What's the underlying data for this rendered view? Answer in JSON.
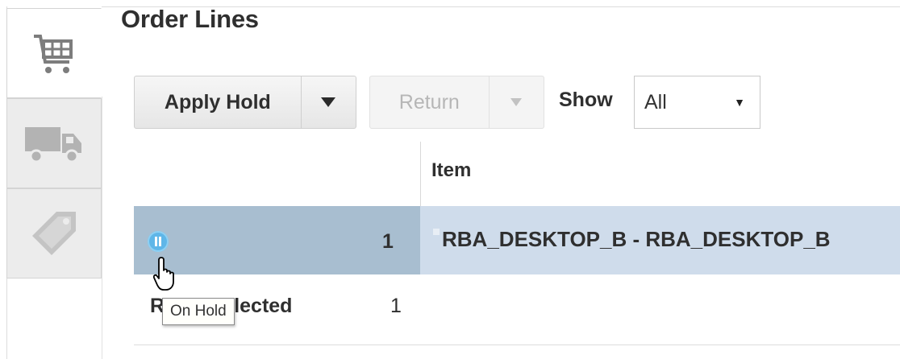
{
  "page": {
    "title": "Order Lines"
  },
  "side_tabs": [
    {
      "icon": "shopping-cart-icon",
      "active": true
    },
    {
      "icon": "truck-icon",
      "active": false
    },
    {
      "icon": "price-tag-icon",
      "active": false
    }
  ],
  "toolbar": {
    "apply_hold_label": "Apply Hold",
    "return_label": "Return",
    "show_label": "Show",
    "show_value": "All"
  },
  "table": {
    "columns": [
      "",
      "Item"
    ],
    "rows": [
      {
        "status_icon": "on-hold-icon",
        "line_number": "1",
        "item": "RBA_DESKTOP_B - RBA_DESKTOP_B",
        "selected": true
      }
    ],
    "footer": {
      "label": "Rows Selected",
      "count": "1"
    }
  },
  "tooltip": {
    "text": "On Hold"
  },
  "colors": {
    "selected_row": "#cfdceb",
    "selected_row_key": "#a8bed0",
    "hold_icon": "#5fb6e8"
  }
}
